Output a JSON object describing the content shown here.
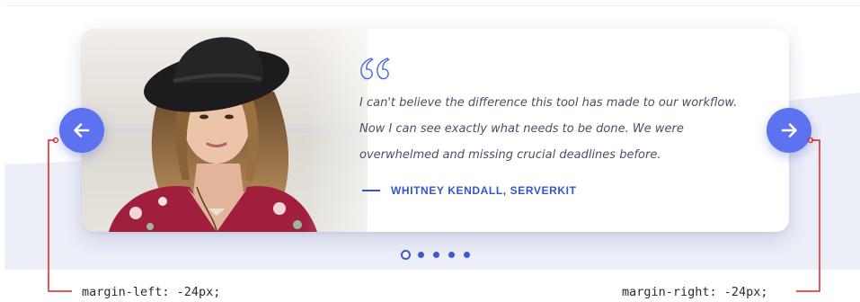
{
  "testimonial": {
    "quote_lines": [
      "I can't believe the difference this tool has made to our workflow.",
      "Now I can see exactly what needs to be done. We were",
      "overwhelmed and missing crucial deadlines before."
    ],
    "author": "WHITNEY KENDALL, SERVERKIT"
  },
  "carousel": {
    "prev_icon": "arrow-left-icon",
    "next_icon": "arrow-right-icon",
    "dot_count": 5,
    "active_dot": 1
  },
  "annotations": {
    "left": "margin-left: -24px;",
    "right": "margin-right: -24px;"
  },
  "colors": {
    "accent": "#3555d6",
    "button": "#5c72ee",
    "annotation_line": "#e02020",
    "wave": "#eceef8"
  }
}
